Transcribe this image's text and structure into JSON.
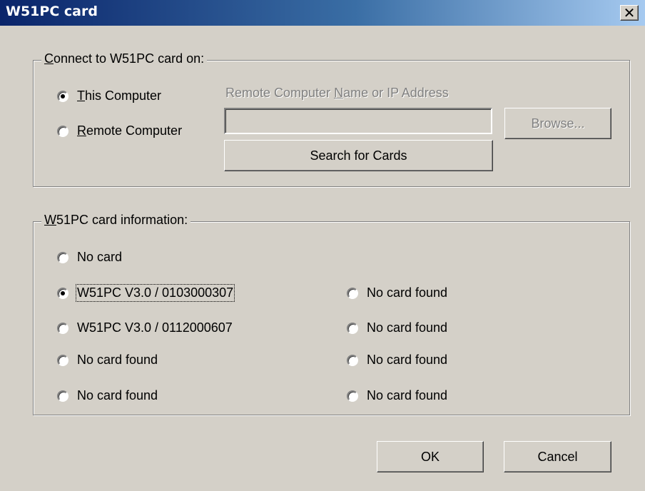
{
  "window": {
    "title": "W51PC card",
    "close_glyph": "✕"
  },
  "connect_group": {
    "legend_prefix": "C",
    "legend_rest": "onnect to W51PC card on:",
    "this_computer": {
      "u": "T",
      "rest": "his Computer",
      "checked": true
    },
    "remote_computer": {
      "u": "R",
      "rest": "emote Computer",
      "checked": false
    },
    "remote_label_a": "Remote Computer ",
    "remote_label_u": "N",
    "remote_label_b": "ame or IP Address",
    "remote_input_value": "",
    "browse_label": "Browse...",
    "search_label": "Search for Cards"
  },
  "card_group": {
    "legend_prefix": "W",
    "legend_rest": "51PC card information:",
    "no_card": "No card",
    "left_cards": [
      "W51PC  V3.0 / 0103000307",
      "W51PC  V3.0 / 0112000607",
      "No card found",
      "No card found"
    ],
    "right_cards": [
      "No card found",
      "No card found",
      "No card found",
      "No card found"
    ],
    "selected": "W51PC  V3.0 / 0103000307"
  },
  "buttons": {
    "ok": "OK",
    "cancel": "Cancel"
  }
}
